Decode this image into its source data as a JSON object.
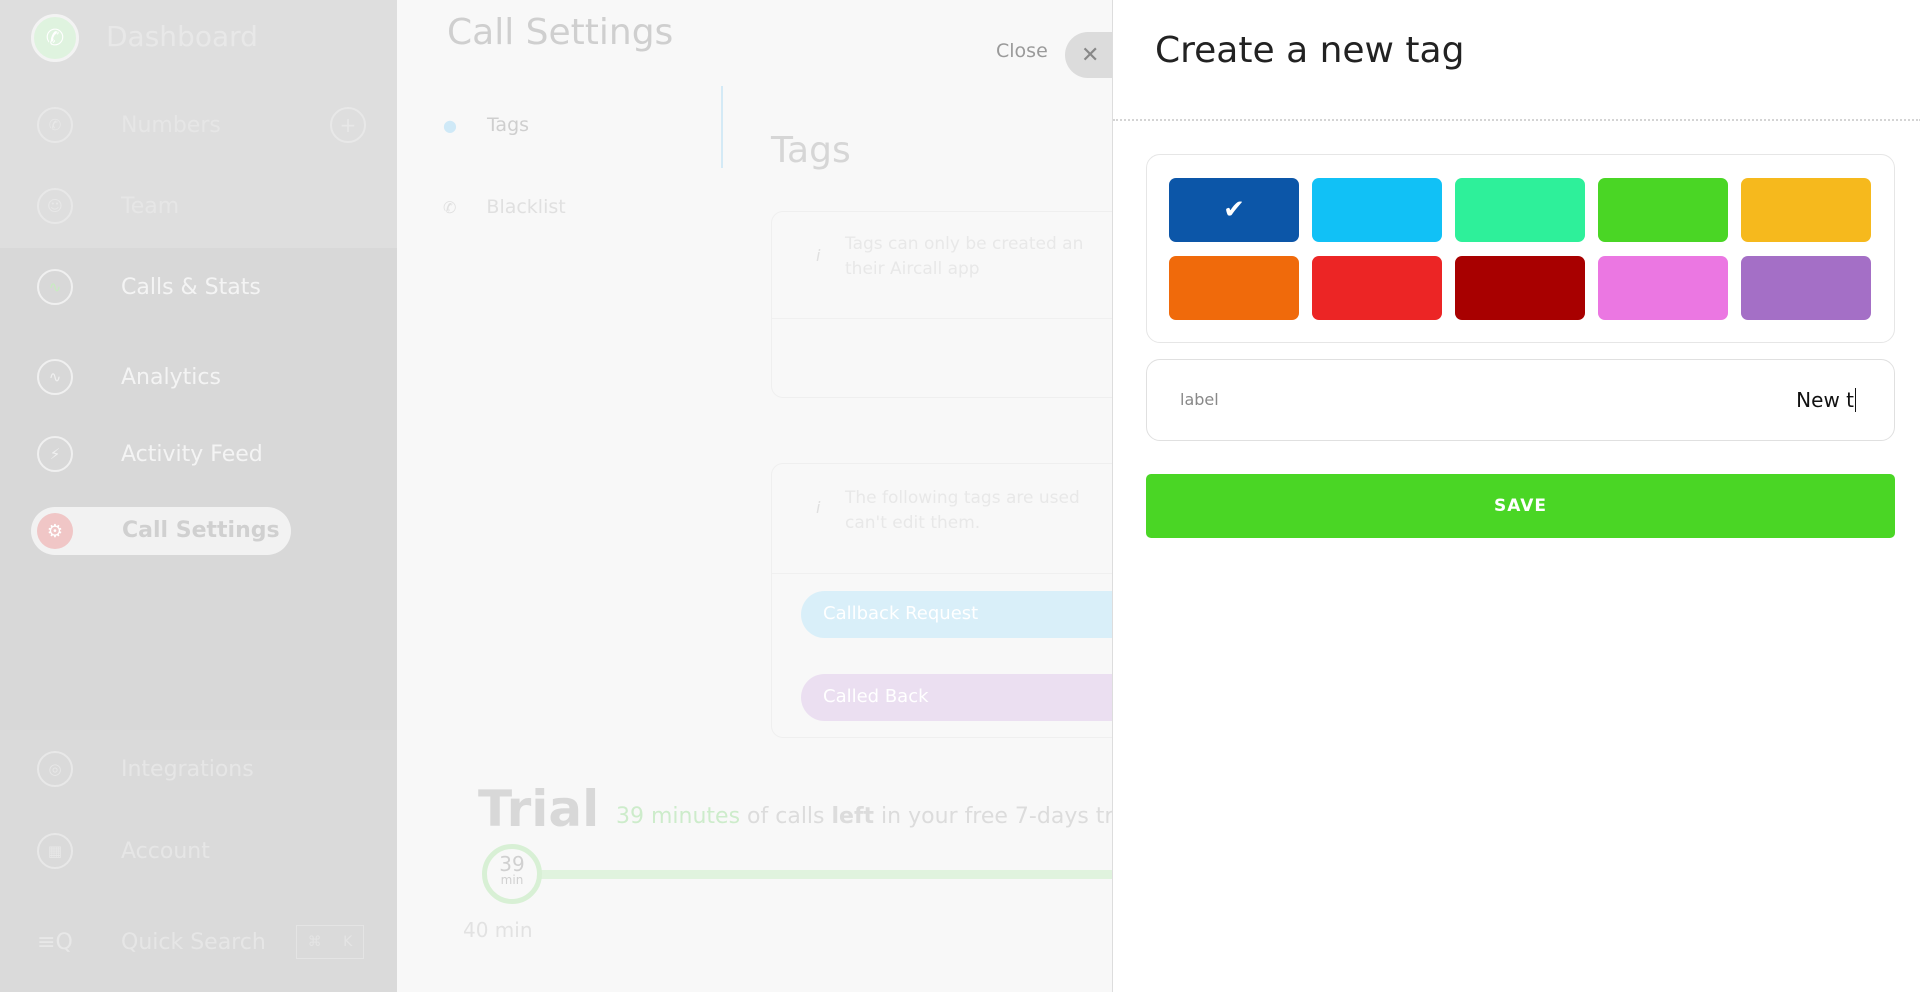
{
  "sidebar": {
    "dashboard": "Dashboard",
    "items": [
      {
        "label": "Numbers",
        "icon": "phone-icon"
      },
      {
        "label": "Team",
        "icon": "user-icon"
      },
      {
        "label": "Calls & Stats",
        "icon": "stats-icon"
      },
      {
        "label": "Analytics",
        "icon": "analytics-icon"
      },
      {
        "label": "Activity Feed",
        "icon": "lightning-icon"
      },
      {
        "label": "Call Settings",
        "icon": "gear-icon"
      },
      {
        "label": "Integrations",
        "icon": "integrations-icon"
      },
      {
        "label": "Account",
        "icon": "building-icon"
      },
      {
        "label": "Quick Search",
        "icon": "search-icon"
      }
    ],
    "shortcut": [
      "⌘",
      "K"
    ]
  },
  "main": {
    "title": "Call Settings",
    "close_label": "Close",
    "nav": [
      {
        "label": "Tags"
      },
      {
        "label": "Blacklist"
      }
    ],
    "tags_heading": "Tags",
    "info1": [
      "Tags can only be created an",
      "their Aircall app"
    ],
    "info2": [
      "The following tags are used",
      "can't edit them."
    ],
    "default_tags": [
      {
        "label": "Callback Request",
        "color": "#d6eef8"
      },
      {
        "label": "Called Back",
        "color": "#e8dcf0"
      }
    ],
    "trial": {
      "title": "Trial",
      "minutes": "39 minutes",
      "text1": " of calls ",
      "bold": "left",
      "text2": " in your free 7-days tri",
      "circle_value": "39",
      "circle_unit": "min",
      "total": "40 min",
      "remaining_fraction": 0.975
    }
  },
  "panel": {
    "title": "Create a new tag",
    "colors": [
      "#0c56a8",
      "#11c1f6",
      "#2ef09a",
      "#4ad625",
      "#f6b91d",
      "#f06a0b",
      "#ec2525",
      "#a80000",
      "#eb77e2",
      "#a46fc6"
    ],
    "selected_index": 0,
    "label_caption": "label",
    "label_value": "New t",
    "save_label": "SAVE",
    "save_color": "#4ad625"
  }
}
